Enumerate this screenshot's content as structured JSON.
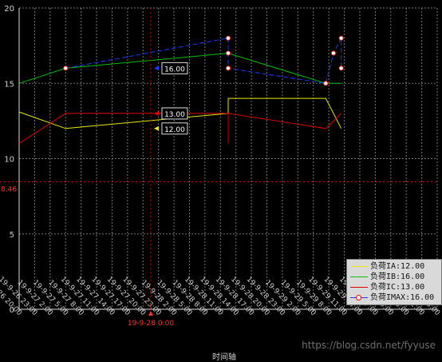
{
  "chart_data": {
    "type": "line",
    "xlabel": "时间轴",
    "ylabel": "",
    "ylim": [
      0,
      20
    ],
    "yticks": [
      "0",
      "5",
      "10",
      "15",
      "20"
    ],
    "grid": true,
    "legend_position": "bottom-right",
    "x_tick_labels": [
      "19-9-26 20:00",
      "19-9-26 23:00",
      "19-9-27 2:00",
      "19-9-27 5:00",
      "19-9-27 8:00",
      "19-9-27 11:00",
      "19-9-27 14:00",
      "19-9-27 17:00",
      "19-9-27 20:00",
      "19-9-27 23:00",
      "19-9-28 2:00",
      "19-9-28 5:00",
      "19-9-28 8:00",
      "19-9-28 11:00",
      "19-9-28 14:00",
      "19-9-28 17:00",
      "19-9-28 20:00",
      "19-9-28 23:00",
      "19-9-29 2:00",
      "19-9-29 5:00",
      "19-9-29 8:00",
      "19-9-29 11:00",
      "19-9-29 14:00",
      "19-9-29 17:00",
      "19-9-29 20:00",
      "19-9-29 23:00",
      "19-9-30 2:00",
      "19-9-30 5:00"
    ],
    "x": [
      0,
      1,
      2,
      3,
      4,
      5,
      6,
      7,
      8,
      9,
      10,
      11,
      12,
      13,
      14,
      15,
      16,
      17,
      18,
      19,
      20,
      21,
      22,
      23,
      24,
      25,
      26,
      27
    ],
    "series": [
      {
        "name": "负荷IA:12.00",
        "color": "#e8e800",
        "points": [
          [
            0,
            13.1
          ],
          [
            3,
            12.0
          ],
          [
            13.5,
            13.0
          ],
          [
            13.5,
            14.0
          ],
          [
            19.8,
            14.0
          ],
          [
            20.8,
            12.0
          ]
        ]
      },
      {
        "name": "负荷IB:16.00",
        "color": "#00c000",
        "points": [
          [
            0,
            15.0
          ],
          [
            3,
            16.0
          ],
          [
            13.5,
            17.0
          ],
          [
            19.8,
            15.0
          ],
          [
            20.8,
            15.0
          ]
        ]
      },
      {
        "name": "负荷IC:13.00",
        "color": "#e00000",
        "points": [
          [
            0,
            11.0
          ],
          [
            3,
            13.0
          ],
          [
            13.5,
            13.0
          ],
          [
            13.5,
            11.0
          ],
          [
            13.5,
            13.0
          ],
          [
            19.8,
            12.0
          ],
          [
            20.8,
            13.0
          ]
        ]
      },
      {
        "name": "负荷IMAX:16.00",
        "color": "#1a3aff",
        "marker": "white-circle-red-edge",
        "points": [
          [
            3,
            16.0
          ],
          [
            13.5,
            18.0
          ],
          [
            13.5,
            17.0
          ],
          [
            13.5,
            16.0
          ],
          [
            19.8,
            15.0
          ],
          [
            20.3,
            17.0
          ],
          [
            20.8,
            18.0
          ],
          [
            20.8,
            16.0
          ]
        ]
      }
    ],
    "hover": {
      "time_label": "19-9-28 0:00",
      "x": 8.5,
      "y_value_label": "8.46",
      "y_value": 8.46,
      "callouts": [
        {
          "value": 16.0,
          "label": "16.00",
          "color": "#1a3aff"
        },
        {
          "value": 13.0,
          "label": "13.00",
          "color": "#e00000"
        },
        {
          "value": 12.0,
          "label": "12.00",
          "color": "#e8e800"
        }
      ]
    }
  },
  "watermark": "https://blog.csdn.net/fyyuse"
}
